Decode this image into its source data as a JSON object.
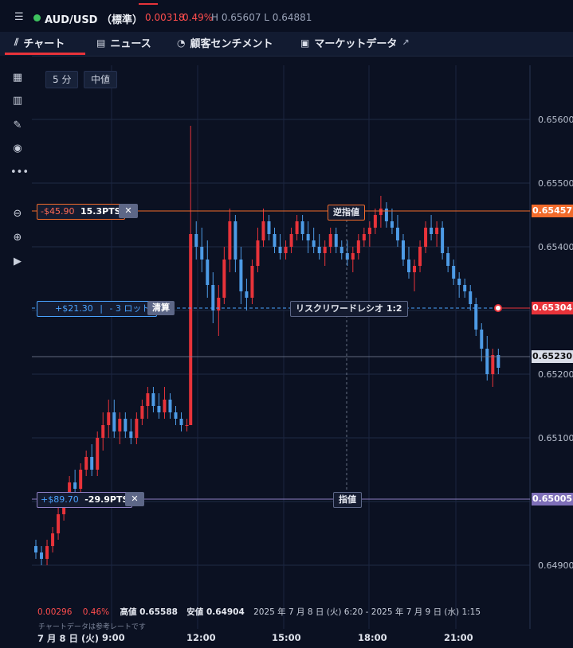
{
  "header": {
    "menu_icon": "hamburger-icon",
    "symbol": "AUD/USD （標準）",
    "change": "0.00318",
    "change_pct": "0.49%",
    "high_low": "H 0.65607 L 0.64881",
    "status_color": "#3ec35f"
  },
  "tabs": [
    {
      "label": "チャート",
      "icon": "candlestick-icon"
    },
    {
      "label": "ニュース",
      "icon": "news-icon"
    },
    {
      "label": "顧客センチメント",
      "icon": "sentiment-icon"
    },
    {
      "label": "マーケットデータ",
      "icon": "clipboard-icon",
      "external_icon": "external-link-icon"
    }
  ],
  "sidebar": [
    "calendar-icon",
    "bar-chart-icon",
    "pencil-icon",
    "eye-icon",
    "more-icon",
    "zoom-out-icon",
    "zoom-in-icon",
    "skip-forward-icon"
  ],
  "toolbar": {
    "interval": "5 分",
    "price_type": "中値"
  },
  "axis": {
    "ticks": [
      "0.65600",
      "0.65500",
      "0.65400",
      "0.65200",
      "0.65100",
      "0.64900"
    ],
    "last_price_tag": "0.65304",
    "stop_tag": "0.65457",
    "crosshair_tag": "0.65230",
    "limit_tag": "0.65005"
  },
  "orders": {
    "stop": {
      "pnl": "-$45.90",
      "pts": "15.3PTS",
      "label": "逆指値"
    },
    "position": {
      "pnl": "+$21.30",
      "lots": "- 3 ロット",
      "close_label": "清算",
      "rr_label": "リスクリワードレシオ 1:2"
    },
    "limit": {
      "pnl": "+$89.70",
      "pts": "-29.9PTS",
      "label": "指値"
    }
  },
  "footer": {
    "change": "0.00296",
    "change_pct": "0.46%",
    "high": "高値 0.65588",
    "low": "安値 0.64904",
    "range": "2025 年 7 月 8 日 (火) 6:20 - 2025 年 7 月 9 日 (水) 1:15",
    "note": "チャートデータは参考レートです"
  },
  "x_axis": [
    "7 月 8 日 (火)",
    "9:00",
    "12:00",
    "15:00",
    "18:00",
    "21:00"
  ],
  "colors": {
    "up": "#e8333a",
    "down": "#4d9be6",
    "stop": "#f26b2b",
    "position": "#4aa3ff",
    "limit": "#8f80c4"
  },
  "chart_data": {
    "type": "candlestick",
    "ylim": [
      0.6486,
      0.6562
    ],
    "series": [
      {
        "x": 0,
        "o": 0.6493,
        "h": 0.6494,
        "l": 0.6491,
        "c": 0.6492
      },
      {
        "x": 6,
        "o": 0.6492,
        "h": 0.6493,
        "l": 0.649,
        "c": 0.6491
      },
      {
        "x": 12,
        "o": 0.6491,
        "h": 0.6494,
        "l": 0.649,
        "c": 0.6493
      },
      {
        "x": 18,
        "o": 0.6493,
        "h": 0.6496,
        "l": 0.6492,
        "c": 0.6495
      },
      {
        "x": 24,
        "o": 0.6495,
        "h": 0.6499,
        "l": 0.6494,
        "c": 0.6498
      },
      {
        "x": 30,
        "o": 0.6498,
        "h": 0.6501,
        "l": 0.6497,
        "c": 0.65
      },
      {
        "x": 36,
        "o": 0.65,
        "h": 0.6504,
        "l": 0.6499,
        "c": 0.6503
      },
      {
        "x": 42,
        "o": 0.6503,
        "h": 0.6505,
        "l": 0.6501,
        "c": 0.6502
      },
      {
        "x": 48,
        "o": 0.6502,
        "h": 0.6506,
        "l": 0.6501,
        "c": 0.6505
      },
      {
        "x": 54,
        "o": 0.6505,
        "h": 0.6508,
        "l": 0.6504,
        "c": 0.6507
      },
      {
        "x": 60,
        "o": 0.6507,
        "h": 0.6509,
        "l": 0.6504,
        "c": 0.6505
      },
      {
        "x": 66,
        "o": 0.6505,
        "h": 0.6511,
        "l": 0.6504,
        "c": 0.651
      },
      {
        "x": 72,
        "o": 0.651,
        "h": 0.6514,
        "l": 0.6508,
        "c": 0.6512
      },
      {
        "x": 78,
        "o": 0.6512,
        "h": 0.6516,
        "l": 0.651,
        "c": 0.6514
      },
      {
        "x": 84,
        "o": 0.6514,
        "h": 0.6516,
        "l": 0.651,
        "c": 0.6511
      },
      {
        "x": 90,
        "o": 0.6511,
        "h": 0.6514,
        "l": 0.6509,
        "c": 0.6513
      },
      {
        "x": 96,
        "o": 0.6513,
        "h": 0.6514,
        "l": 0.651,
        "c": 0.6511
      },
      {
        "x": 102,
        "o": 0.6511,
        "h": 0.6513,
        "l": 0.6509,
        "c": 0.651
      },
      {
        "x": 108,
        "o": 0.651,
        "h": 0.6514,
        "l": 0.6509,
        "c": 0.6513
      },
      {
        "x": 114,
        "o": 0.6513,
        "h": 0.6516,
        "l": 0.6512,
        "c": 0.6515
      },
      {
        "x": 120,
        "o": 0.6515,
        "h": 0.6518,
        "l": 0.6513,
        "c": 0.6517
      },
      {
        "x": 126,
        "o": 0.6517,
        "h": 0.6518,
        "l": 0.6514,
        "c": 0.6515
      },
      {
        "x": 132,
        "o": 0.6515,
        "h": 0.6517,
        "l": 0.6513,
        "c": 0.6514
      },
      {
        "x": 138,
        "o": 0.6514,
        "h": 0.6518,
        "l": 0.6513,
        "c": 0.6516
      },
      {
        "x": 144,
        "o": 0.6516,
        "h": 0.6517,
        "l": 0.6513,
        "c": 0.6514
      },
      {
        "x": 150,
        "o": 0.6514,
        "h": 0.6515,
        "l": 0.6512,
        "c": 0.6513
      },
      {
        "x": 156,
        "o": 0.6513,
        "h": 0.6514,
        "l": 0.6511,
        "c": 0.6512
      },
      {
        "x": 162,
        "o": 0.6512,
        "h": 0.6513,
        "l": 0.6511,
        "c": 0.6512
      },
      {
        "x": 166,
        "o": 0.6512,
        "h": 0.6559,
        "l": 0.6512,
        "c": 0.6542
      },
      {
        "x": 172,
        "o": 0.6542,
        "h": 0.6544,
        "l": 0.6538,
        "c": 0.654
      },
      {
        "x": 178,
        "o": 0.654,
        "h": 0.6543,
        "l": 0.6536,
        "c": 0.6538
      },
      {
        "x": 184,
        "o": 0.6538,
        "h": 0.6541,
        "l": 0.6532,
        "c": 0.6534
      },
      {
        "x": 190,
        "o": 0.6534,
        "h": 0.6536,
        "l": 0.6528,
        "c": 0.653
      },
      {
        "x": 196,
        "o": 0.653,
        "h": 0.6534,
        "l": 0.6526,
        "c": 0.6532
      },
      {
        "x": 202,
        "o": 0.6532,
        "h": 0.654,
        "l": 0.6531,
        "c": 0.6538
      },
      {
        "x": 208,
        "o": 0.6538,
        "h": 0.6546,
        "l": 0.6536,
        "c": 0.6544
      },
      {
        "x": 214,
        "o": 0.6544,
        "h": 0.6545,
        "l": 0.6536,
        "c": 0.6538
      },
      {
        "x": 220,
        "o": 0.6538,
        "h": 0.654,
        "l": 0.6531,
        "c": 0.6533
      },
      {
        "x": 226,
        "o": 0.6533,
        "h": 0.6535,
        "l": 0.653,
        "c": 0.6532
      },
      {
        "x": 232,
        "o": 0.6532,
        "h": 0.6538,
        "l": 0.6531,
        "c": 0.6537
      },
      {
        "x": 238,
        "o": 0.6537,
        "h": 0.6543,
        "l": 0.6536,
        "c": 0.6541
      },
      {
        "x": 244,
        "o": 0.6541,
        "h": 0.6546,
        "l": 0.654,
        "c": 0.6544
      },
      {
        "x": 250,
        "o": 0.6544,
        "h": 0.6545,
        "l": 0.6541,
        "c": 0.6542
      },
      {
        "x": 256,
        "o": 0.6542,
        "h": 0.6543,
        "l": 0.6539,
        "c": 0.654
      },
      {
        "x": 262,
        "o": 0.654,
        "h": 0.6542,
        "l": 0.6538,
        "c": 0.6539
      },
      {
        "x": 268,
        "o": 0.6539,
        "h": 0.6541,
        "l": 0.6538,
        "c": 0.654
      },
      {
        "x": 274,
        "o": 0.654,
        "h": 0.6543,
        "l": 0.6539,
        "c": 0.6542
      },
      {
        "x": 280,
        "o": 0.6542,
        "h": 0.6545,
        "l": 0.6541,
        "c": 0.6544
      },
      {
        "x": 286,
        "o": 0.6544,
        "h": 0.6545,
        "l": 0.6541,
        "c": 0.6542
      },
      {
        "x": 292,
        "o": 0.6542,
        "h": 0.6544,
        "l": 0.6539,
        "c": 0.6541
      },
      {
        "x": 298,
        "o": 0.6541,
        "h": 0.6543,
        "l": 0.6539,
        "c": 0.654
      },
      {
        "x": 304,
        "o": 0.654,
        "h": 0.6542,
        "l": 0.6538,
        "c": 0.6539
      },
      {
        "x": 310,
        "o": 0.6539,
        "h": 0.6541,
        "l": 0.6537,
        "c": 0.654
      },
      {
        "x": 316,
        "o": 0.654,
        "h": 0.6543,
        "l": 0.6539,
        "c": 0.6542
      },
      {
        "x": 322,
        "o": 0.6542,
        "h": 0.6543,
        "l": 0.6539,
        "c": 0.654
      },
      {
        "x": 328,
        "o": 0.654,
        "h": 0.6541,
        "l": 0.6538,
        "c": 0.6539
      },
      {
        "x": 334,
        "o": 0.6539,
        "h": 0.6541,
        "l": 0.6537,
        "c": 0.6538
      },
      {
        "x": 340,
        "o": 0.6538,
        "h": 0.654,
        "l": 0.6536,
        "c": 0.6539
      },
      {
        "x": 346,
        "o": 0.6539,
        "h": 0.6542,
        "l": 0.6538,
        "c": 0.6541
      },
      {
        "x": 352,
        "o": 0.6541,
        "h": 0.6543,
        "l": 0.654,
        "c": 0.6542
      },
      {
        "x": 358,
        "o": 0.6542,
        "h": 0.6544,
        "l": 0.654,
        "c": 0.6543
      },
      {
        "x": 364,
        "o": 0.6543,
        "h": 0.6546,
        "l": 0.6542,
        "c": 0.6545
      },
      {
        "x": 370,
        "o": 0.6545,
        "h": 0.6548,
        "l": 0.6543,
        "c": 0.6546
      },
      {
        "x": 376,
        "o": 0.6546,
        "h": 0.6547,
        "l": 0.6543,
        "c": 0.6544
      },
      {
        "x": 382,
        "o": 0.6544,
        "h": 0.6546,
        "l": 0.6542,
        "c": 0.6543
      },
      {
        "x": 388,
        "o": 0.6543,
        "h": 0.6545,
        "l": 0.654,
        "c": 0.6541
      },
      {
        "x": 394,
        "o": 0.6541,
        "h": 0.6542,
        "l": 0.6537,
        "c": 0.6538
      },
      {
        "x": 400,
        "o": 0.6538,
        "h": 0.654,
        "l": 0.6535,
        "c": 0.6536
      },
      {
        "x": 406,
        "o": 0.6536,
        "h": 0.6538,
        "l": 0.6533,
        "c": 0.6537
      },
      {
        "x": 412,
        "o": 0.6537,
        "h": 0.6541,
        "l": 0.6536,
        "c": 0.654
      },
      {
        "x": 418,
        "o": 0.654,
        "h": 0.6544,
        "l": 0.6539,
        "c": 0.6543
      },
      {
        "x": 424,
        "o": 0.6543,
        "h": 0.6545,
        "l": 0.6541,
        "c": 0.6542
      },
      {
        "x": 430,
        "o": 0.6542,
        "h": 0.6544,
        "l": 0.654,
        "c": 0.6543
      },
      {
        "x": 436,
        "o": 0.6543,
        "h": 0.6544,
        "l": 0.6538,
        "c": 0.6539
      },
      {
        "x": 442,
        "o": 0.6539,
        "h": 0.654,
        "l": 0.6536,
        "c": 0.6537
      },
      {
        "x": 448,
        "o": 0.6537,
        "h": 0.6538,
        "l": 0.6534,
        "c": 0.6535
      },
      {
        "x": 454,
        "o": 0.6535,
        "h": 0.6536,
        "l": 0.6532,
        "c": 0.6534
      },
      {
        "x": 460,
        "o": 0.6534,
        "h": 0.6535,
        "l": 0.6532,
        "c": 0.6533
      },
      {
        "x": 466,
        "o": 0.6533,
        "h": 0.6534,
        "l": 0.653,
        "c": 0.6531
      },
      {
        "x": 472,
        "o": 0.6531,
        "h": 0.6532,
        "l": 0.6526,
        "c": 0.6527
      },
      {
        "x": 478,
        "o": 0.6527,
        "h": 0.6528,
        "l": 0.6522,
        "c": 0.6524
      },
      {
        "x": 484,
        "o": 0.6524,
        "h": 0.6526,
        "l": 0.6519,
        "c": 0.652
      },
      {
        "x": 490,
        "o": 0.652,
        "h": 0.6524,
        "l": 0.6518,
        "c": 0.6523
      },
      {
        "x": 496,
        "o": 0.6523,
        "h": 0.6524,
        "l": 0.652,
        "c": 0.6521
      }
    ]
  }
}
